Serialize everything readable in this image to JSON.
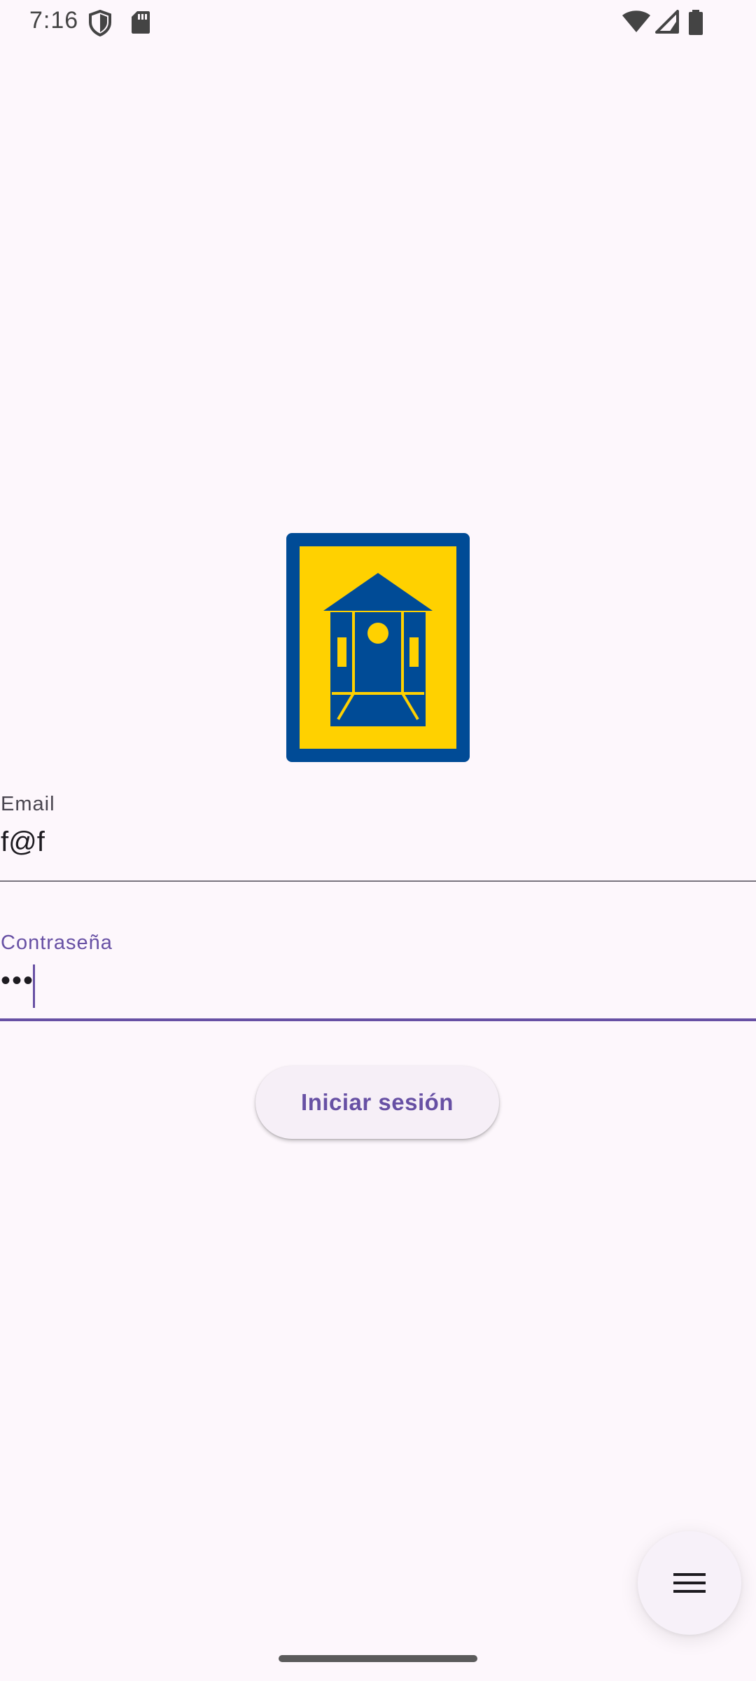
{
  "status_bar": {
    "time": "7:16",
    "left_icons": [
      "shield-icon",
      "sd-card-icon"
    ],
    "right_icons": [
      "wifi-icon",
      "signal-icon",
      "battery-icon"
    ]
  },
  "logo": {
    "icon": "train-station-logo",
    "colors": {
      "frame": "#004b96",
      "background": "#ffd100"
    }
  },
  "form": {
    "email": {
      "label": "Email",
      "value": "f@f"
    },
    "password": {
      "label": "Contraseña",
      "value": "•••"
    },
    "login_label": "Iniciar sesión"
  },
  "fab": {
    "icon": "menu-icon"
  },
  "colors": {
    "primary": "#6750a4",
    "background": "#fdf7fc"
  }
}
